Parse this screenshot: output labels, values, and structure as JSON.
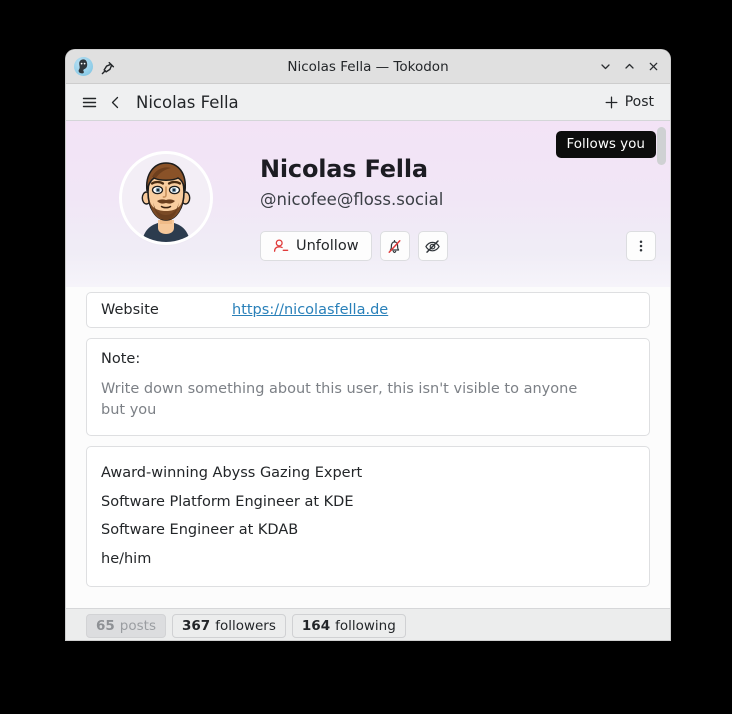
{
  "window": {
    "title": "Nicolas Fella — Tokodon",
    "app_icon": "tokodon-icon",
    "pin_icon": "pin-icon",
    "controls": {
      "minimize": "minimize-icon",
      "maximize": "maximize-icon",
      "close": "close-icon"
    }
  },
  "toolbar": {
    "menu_icon": "hamburger-menu-icon",
    "back_icon": "back-chevron-icon",
    "page_title": "Nicolas Fella",
    "post_label": "Post",
    "post_icon": "plus-icon"
  },
  "profile": {
    "badge": "Follows you",
    "avatar_icon": "user-avatar",
    "display_name": "Nicolas Fella",
    "handle": "@nicofee@floss.social",
    "unfollow_label": "Unfollow",
    "unfollow_icon": "person-remove-icon",
    "mute_notifications_icon": "bell-slash-icon",
    "hide_boosts_icon": "eye-slash-icon",
    "overflow_icon": "more-vertical-icon"
  },
  "fields": {
    "website_label": "Website",
    "website_value": "https://nicolasfella.de"
  },
  "note": {
    "title": "Note:",
    "placeholder": "Write down something about this user, this isn't visible to anyone but you"
  },
  "bio": {
    "lines": [
      "Award-winning Abyss Gazing Expert",
      "Software Platform Engineer at KDE",
      "Software Engineer at KDAB",
      "he/him"
    ]
  },
  "stats": [
    {
      "num": "65",
      "label": "posts",
      "active": true
    },
    {
      "num": "367",
      "label": "followers",
      "active": false
    },
    {
      "num": "164",
      "label": "following",
      "active": false
    }
  ],
  "colors": {
    "accent_link": "#2980b9",
    "badge_bg": "#0d0d0d",
    "banner_top": "#f3e3f6",
    "unfollow_icon": "#e03b3b"
  }
}
